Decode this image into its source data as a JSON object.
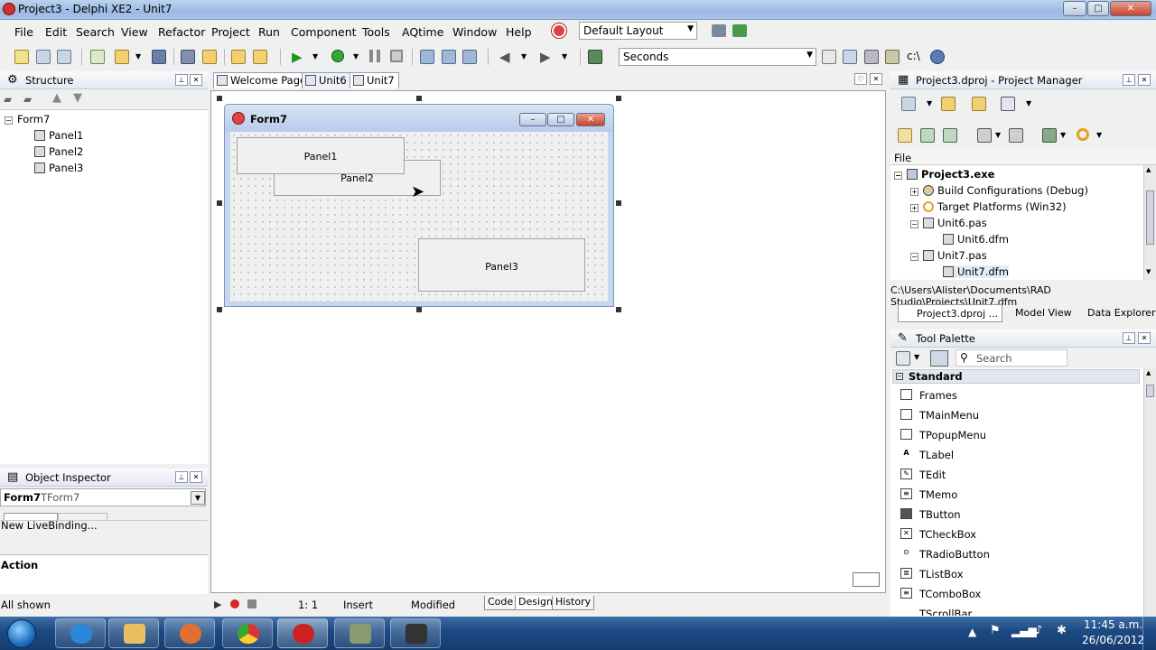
{
  "window": {
    "title": "Project3 - Delphi XE2 - Unit7",
    "min": "–",
    "max": "□",
    "close": "✕"
  },
  "menu": [
    "File",
    "Edit",
    "Search",
    "View",
    "Refactor",
    "Project",
    "Run",
    "Component",
    "Tools",
    "AQtime",
    "Window",
    "Help"
  ],
  "layout_combo": "Default Layout",
  "seconds_combo": "Seconds",
  "toolbar_extra": "c:\\",
  "structure": {
    "title": "Structure",
    "root": "Form7",
    "children": [
      "Panel1",
      "Panel2",
      "Panel3"
    ]
  },
  "tabs": [
    "Welcome Page",
    "Unit6",
    "Unit7"
  ],
  "form": {
    "title": "Form7",
    "panels": {
      "p1": "Panel1",
      "p2": "Panel2",
      "p3": "Panel3"
    }
  },
  "project_manager": {
    "title": "Project3.dproj - Project Manager",
    "column": "File",
    "items": [
      {
        "label": "Project3.exe",
        "bold": true
      },
      {
        "label": "Build Configurations (Debug)"
      },
      {
        "label": "Target Platforms (Win32)"
      },
      {
        "label": "Unit6.pas"
      },
      {
        "label": "Unit6.dfm"
      },
      {
        "label": "Unit7.pas"
      },
      {
        "label": "Unit7.dfm"
      }
    ],
    "path": "C:\\Users\\Alister\\Documents\\RAD Studio\\Projects\\Unit7.dfm",
    "bottom_tabs": [
      "Project3.dproj ...",
      "Model View",
      "Data Explorer"
    ]
  },
  "tool_palette": {
    "title": "Tool Palette",
    "search_placeholder": "Search",
    "category": "Standard",
    "items": [
      "Frames",
      "TMainMenu",
      "TPopupMenu",
      "TLabel",
      "TEdit",
      "TMemo",
      "TButton",
      "TCheckBox",
      "TRadioButton",
      "TListBox",
      "TComboBox",
      "TScrollBar"
    ]
  },
  "object_inspector": {
    "title": "Object Inspector",
    "object": "Form7",
    "class": "TForm7",
    "livebinding": "New LiveBinding...",
    "section": "Action",
    "filter": "All shown"
  },
  "status": {
    "position": "1:   1",
    "mode": "Insert",
    "state": "Modified",
    "tabs": [
      "Code",
      "Design",
      "History"
    ]
  },
  "taskbar": {
    "time": "11:45 a.m.",
    "date": "26/06/2012"
  },
  "colors": {
    "accent": "#3f6fa7",
    "close": "#c7432c"
  }
}
